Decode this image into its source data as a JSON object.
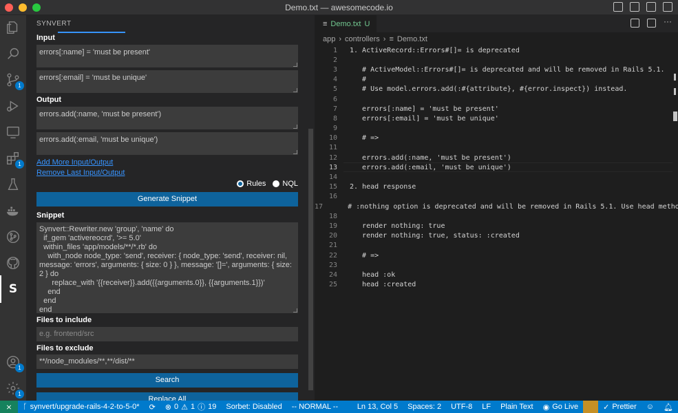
{
  "window": {
    "title": "Demo.txt — awesomecode.io"
  },
  "sidebar": {
    "title": "SYNVERT",
    "input_label": "Input",
    "inputs": [
      "errors[:name] = 'must be present'",
      "errors[:email] = 'must be unique'"
    ],
    "output_label": "Output",
    "outputs": [
      "errors.add(:name, 'must be present')",
      "errors.add(:email, 'must be unique')"
    ],
    "add_link": "Add More Input/Output",
    "remove_link": "Remove Last Input/Output",
    "radio_rules": "Rules",
    "radio_nql": "NQL",
    "generate_button": "Generate Snippet",
    "snippet_label": "Snippet",
    "snippet": "Synvert::Rewriter.new 'group', 'name' do\n  if_gem 'activereocrd', '>= 5.0'\n  within_files 'app/models/**/*.rb' do\n    with_node node_type: 'send', receiver: { node_type: 'send', receiver: nil,\nmessage: 'errors', arguments: { size: 0 } }, message: '[]=', arguments: { size:\n2 } do\n      replace_with '{{receiver}}.add({{arguments.0}}, {{arguments.1}})'\n    end\n  end\nend",
    "files_include_label": "Files to include",
    "files_include_placeholder": "e.g. frontend/src",
    "files_exclude_label": "Files to exclude",
    "files_exclude_value": "**/node_modules/**,**/dist/**",
    "search_button": "Search",
    "replace_all_button": "Replace All"
  },
  "activity": {
    "badges": {
      "source_control": "1",
      "account": "1",
      "settings": "1"
    }
  },
  "editor": {
    "tab": {
      "name": "Demo.txt",
      "status": "U"
    },
    "breadcrumbs": [
      "app",
      "controllers",
      "Demo.txt"
    ],
    "lines": [
      {
        "n": "1",
        "t": "1. ActiveRecord::Errors#[]= is deprecated"
      },
      {
        "n": "2",
        "t": ""
      },
      {
        "n": "3",
        "t": "   # ActiveModel::Errors#[]= is deprecated and will be removed in Rails 5.1."
      },
      {
        "n": "4",
        "t": "   #"
      },
      {
        "n": "5",
        "t": "   # Use model.errors.add(:#{attribute}, #{error.inspect}) instead."
      },
      {
        "n": "6",
        "t": ""
      },
      {
        "n": "7",
        "t": "   errors[:name] = 'must be present'"
      },
      {
        "n": "8",
        "t": "   errors[:email] = 'must be unique'"
      },
      {
        "n": "9",
        "t": ""
      },
      {
        "n": "10",
        "t": "   # =>"
      },
      {
        "n": "11",
        "t": ""
      },
      {
        "n": "12",
        "t": "   errors.add(:name, 'must be present')"
      },
      {
        "n": "13",
        "t": "   errors.add(:email, 'must be unique')"
      },
      {
        "n": "14",
        "t": ""
      },
      {
        "n": "15",
        "t": "2. head response"
      },
      {
        "n": "16",
        "t": ""
      },
      {
        "n": "17",
        "t": "   # :nothing option is deprecated and will be removed in Rails 5.1. Use head metho"
      },
      {
        "n": "18",
        "t": ""
      },
      {
        "n": "19",
        "t": "   render nothing: true"
      },
      {
        "n": "20",
        "t": "   render nothing: true, status: :created"
      },
      {
        "n": "21",
        "t": ""
      },
      {
        "n": "22",
        "t": "   # =>"
      },
      {
        "n": "23",
        "t": ""
      },
      {
        "n": "24",
        "t": "   head :ok"
      },
      {
        "n": "25",
        "t": "   head :created"
      }
    ]
  },
  "statusbar": {
    "branch": "synvert/upgrade-rails-4-2-to-5-0*",
    "errors": "0",
    "warnings": "1",
    "info": "19",
    "sorbet": "Sorbet: Disabled",
    "mode": "-- NORMAL --",
    "position": "Ln 13, Col 5",
    "spaces": "Spaces: 2",
    "encoding": "UTF-8",
    "eol": "LF",
    "language": "Plain Text",
    "golive": "Go Live",
    "prettier": "Prettier"
  }
}
